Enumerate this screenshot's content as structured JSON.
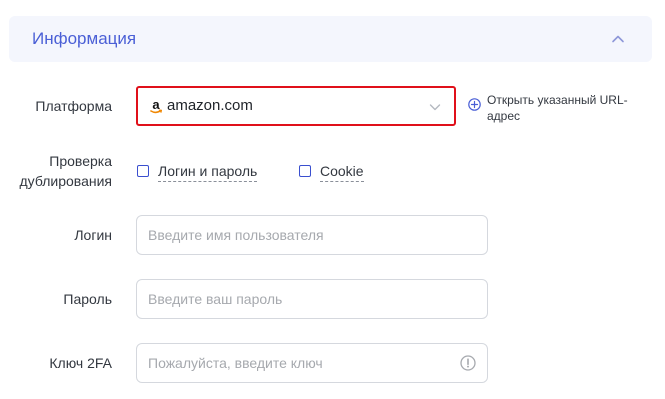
{
  "section": {
    "title": "Информация"
  },
  "platform": {
    "label": "Платформа",
    "selected": "amazon.com",
    "open_url_text": "Открыть указанный URL-адрес"
  },
  "duplicate_check": {
    "label_line1": "Проверка",
    "label_line2": "дублирования",
    "options": [
      {
        "label": "Логин и пароль",
        "checked": false
      },
      {
        "label": "Cookie",
        "checked": false
      }
    ]
  },
  "login": {
    "label": "Логин",
    "placeholder": "Введите имя пользователя",
    "value": ""
  },
  "password": {
    "label": "Пароль",
    "placeholder": "Введите ваш пароль",
    "value": ""
  },
  "key2fa": {
    "label": "Ключ 2FA",
    "placeholder": "Пожалуйста, введите ключ",
    "value": ""
  },
  "colors": {
    "accent": "#4a5fd6",
    "header_bg": "#f4f6fd",
    "highlight_border": "#e0101a"
  },
  "icons": {
    "collapse": "chevron-up-icon",
    "dropdown": "chevron-down-icon",
    "open_url": "plus-circle-icon",
    "platform_logo": "amazon-logo-icon",
    "key_hint": "info-circle-icon"
  }
}
